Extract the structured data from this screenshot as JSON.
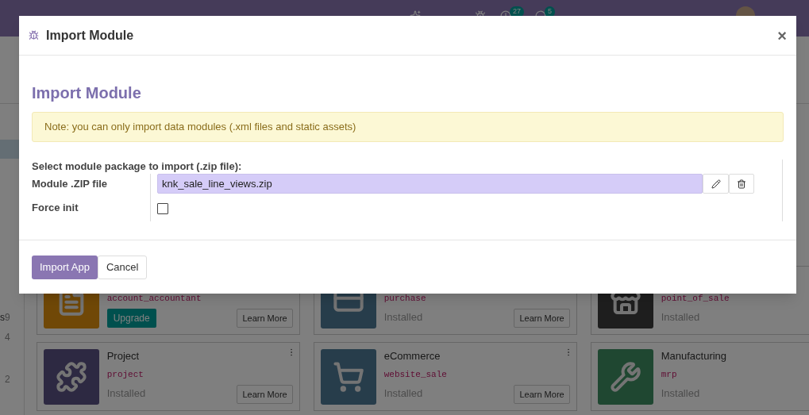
{
  "navbar": {
    "activity_badge": "27",
    "message_badge": "5"
  },
  "sidebar": {
    "items": [
      {
        "label": "s",
        "count": "9"
      },
      {
        "count": "4"
      },
      {
        "count": "2"
      }
    ]
  },
  "apps": [
    {
      "technical_name": "account_accountant",
      "action_label": "Upgrade",
      "learn_more": "Learn More"
    },
    {
      "technical_name": "purchase",
      "status": "Installed",
      "learn_more": "Learn More"
    },
    {
      "technical_name": "point_of_sale",
      "status": "Installed"
    },
    {
      "name": "Project",
      "technical_name": "project",
      "status": "Installed",
      "learn_more": "Learn More",
      "menu": true
    },
    {
      "name": "eCommerce",
      "technical_name": "website_sale",
      "status": "Installed",
      "learn_more": "Learn More",
      "menu": true
    },
    {
      "name": "Manufacturing",
      "technical_name": "mrp",
      "status": "Installed"
    }
  ],
  "modal": {
    "title": "Import Module",
    "close": "×",
    "heading": "Import Module",
    "note": "Note: you can only import data modules (.xml files and static assets)",
    "section_label": "Select module package to import (.zip file):",
    "fields": [
      {
        "kind": "file",
        "label": "Module .ZIP file",
        "value": "knk_sale_line_views.zip"
      },
      {
        "kind": "checkbox",
        "label": "Force init",
        "checked": false
      }
    ],
    "buttons": [
      {
        "kind": "primary",
        "label": "Import App"
      },
      {
        "kind": "secondary",
        "label": "Cancel"
      }
    ]
  }
}
